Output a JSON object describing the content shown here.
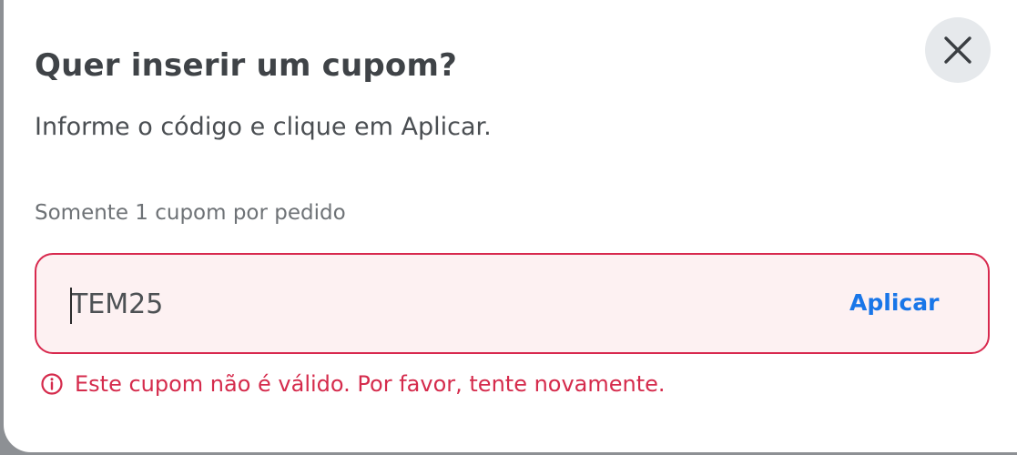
{
  "dialog": {
    "title": "Quer inserir um cupom?",
    "subtitle": "Informe o código e clique em Aplicar.",
    "hint": "Somente 1 cupom por pedido",
    "close_icon": "close-icon"
  },
  "coupon": {
    "value": "TEM25",
    "apply_label": "Aplicar"
  },
  "error": {
    "message": "Este cupom não é válido. Por favor, tente novamente.",
    "icon": "info-circle-icon"
  },
  "colors": {
    "error": "#d52b4c",
    "error_background": "#fdf1f2",
    "accent": "#1976e8",
    "close_button_background": "#e6e9ec"
  }
}
